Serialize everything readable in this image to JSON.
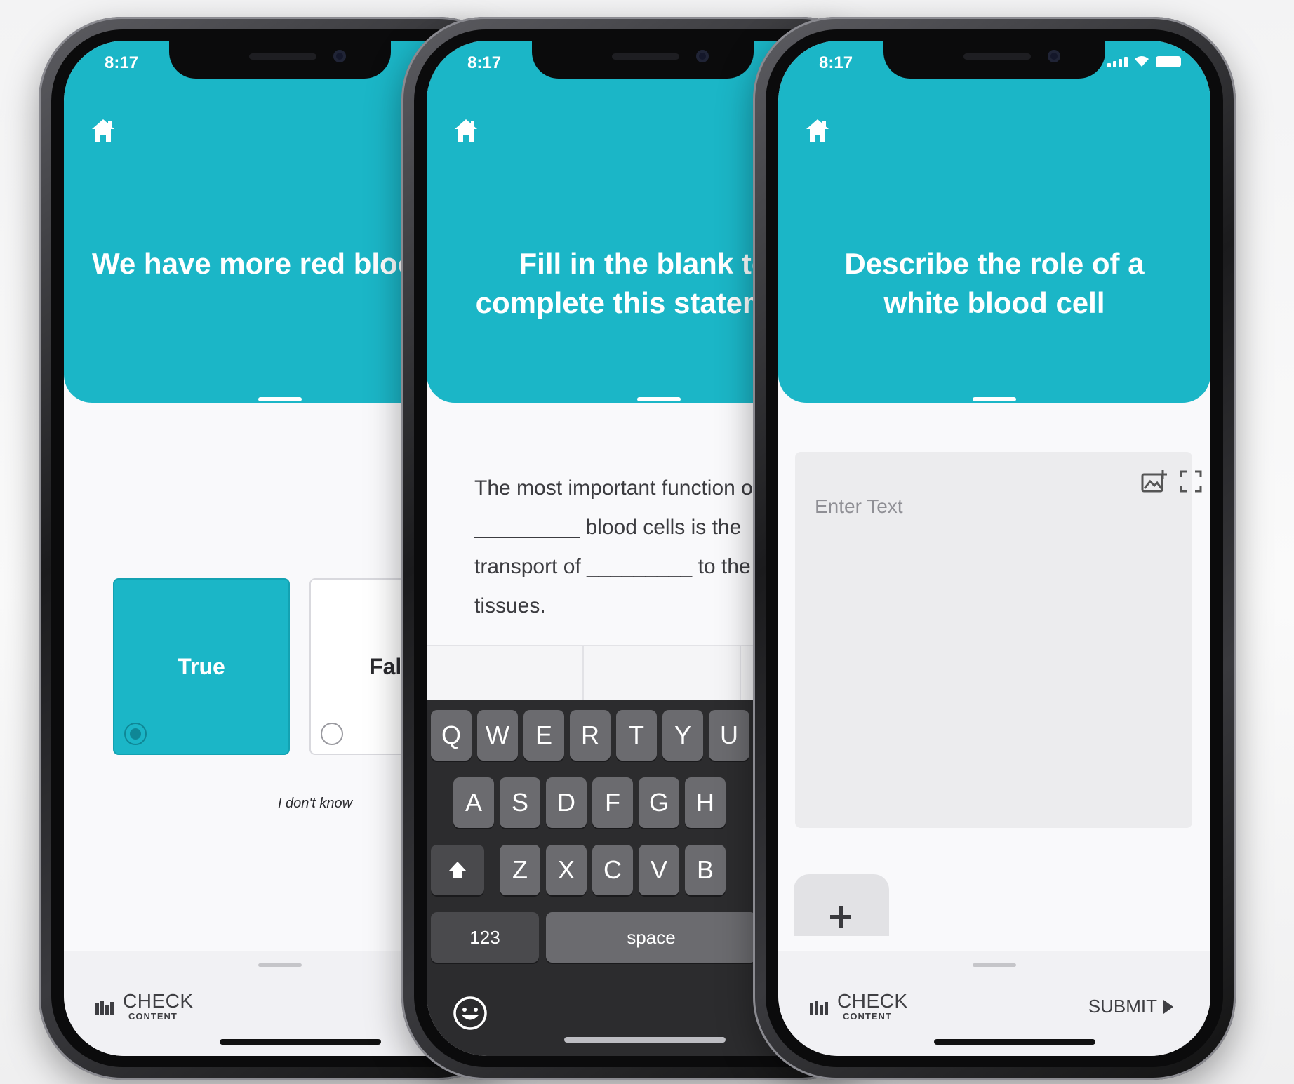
{
  "status": {
    "time": "8:17"
  },
  "screens": [
    {
      "question": "We have more red blood cells than white blood cells",
      "options": [
        {
          "label": "True",
          "selected": true
        },
        {
          "label": "False",
          "selected": false
        }
      ],
      "idk": "I don't know",
      "footer": {
        "check": "CHECK",
        "check_sub": "CONTENT"
      }
    },
    {
      "question": "Fill in the blank to complete this statement",
      "text_lines": [
        "The most important function of",
        "_________ blood cells is the",
        "transport of _________ to the",
        "tissues."
      ],
      "keyboard": {
        "row1": [
          "Q",
          "W",
          "E",
          "R",
          "T",
          "Y",
          "U"
        ],
        "row2": [
          "A",
          "S",
          "D",
          "F",
          "G",
          "H"
        ],
        "row3": [
          "Z",
          "X",
          "C",
          "V",
          "B"
        ],
        "numbers": "123",
        "space": "space"
      }
    },
    {
      "question": "Describe the role of a white blood cell",
      "placeholder": "Enter Text",
      "footer": {
        "check": "CHECK",
        "check_sub": "CONTENT",
        "submit": "SUBMIT"
      }
    }
  ],
  "colors": {
    "accent": "#1bb6c7",
    "background": "#f9f9fb",
    "keyboard": "#2c2c2e"
  },
  "icons": [
    "home-icon",
    "bar-chart-icon",
    "add-image-icon",
    "expand-icon",
    "plus-icon",
    "shift-icon",
    "emoji-icon",
    "play-triangle-icon",
    "signal-icon",
    "wifi-icon",
    "battery-icon"
  ]
}
